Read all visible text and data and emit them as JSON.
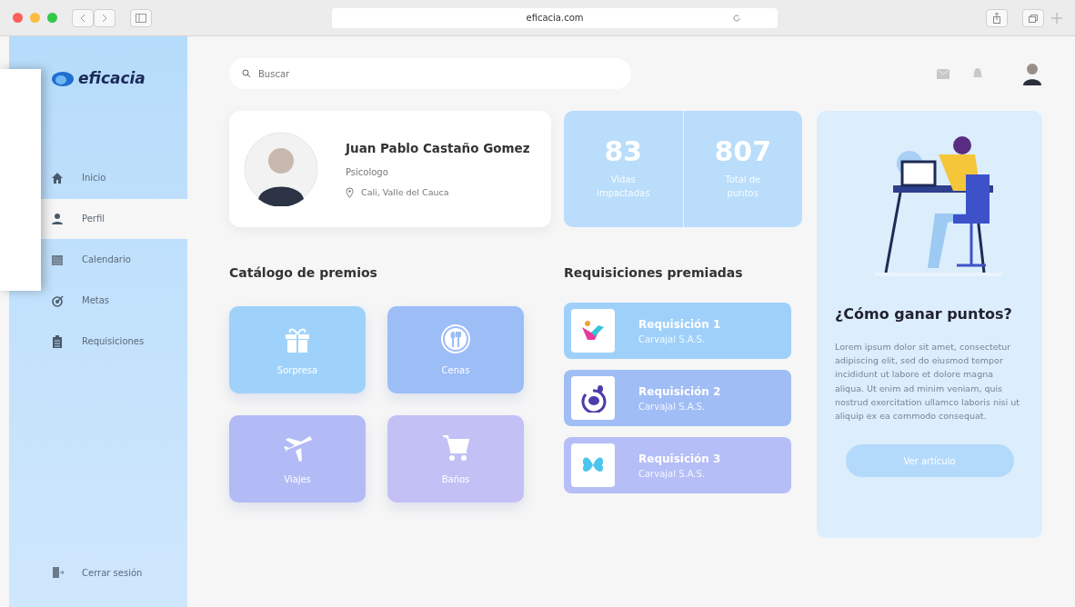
{
  "browser": {
    "address": "eficacia.com"
  },
  "sidebar": {
    "logo": "eficacia",
    "items": [
      {
        "label": "Inicio",
        "selected": false
      },
      {
        "label": "Perfil",
        "selected": true
      },
      {
        "label": "Calendario",
        "selected": false
      },
      {
        "label": "Metas",
        "selected": false
      },
      {
        "label": "Requisiciones",
        "selected": false
      }
    ],
    "logout": "Cerrar sesión"
  },
  "search": {
    "placeholder": "Buscar"
  },
  "profile": {
    "name": "Juan Pablo Castaño Gomez",
    "role": "Psicologo",
    "location": "Cali, Valle del Cauca"
  },
  "stats": [
    {
      "value": "83",
      "label": "Vidas impactadas"
    },
    {
      "value": "807",
      "label": "Total de puntos"
    }
  ],
  "catalog": {
    "title": "Catálogo de premios",
    "items": [
      {
        "label": "Sorpresa",
        "color": "#9fd2fb"
      },
      {
        "label": "Cenas",
        "color": "#9dbdf7"
      },
      {
        "label": "Viajes",
        "color": "#b2bbf6"
      },
      {
        "label": "Baños",
        "color": "#c3c0f6"
      }
    ]
  },
  "requisitions": {
    "title": "Requisiciones premiadas",
    "items": [
      {
        "title": "Requisición 1",
        "company": "Carvajal S.A.S.",
        "color": "#9fd0fa"
      },
      {
        "title": "Requisición 2",
        "company": "Carvajal S.A.S.",
        "color": "#a1bdf6"
      },
      {
        "title": "Requisición 3",
        "company": "Carvajal S.A.S.",
        "color": "#b5bef6"
      }
    ]
  },
  "help": {
    "title": "¿Cómo ganar puntos?",
    "text": "Lorem ipsum dolor sit amet, consectetur adipiscing elit, sed do eiusmod tempor incididunt ut labore et dolore magna aliqua. Ut enim ad minim veniam, quis nostrud exercitation ullamco laboris nisi ut aliquip ex ea commodo consequat.",
    "button": "Ver artículo"
  }
}
